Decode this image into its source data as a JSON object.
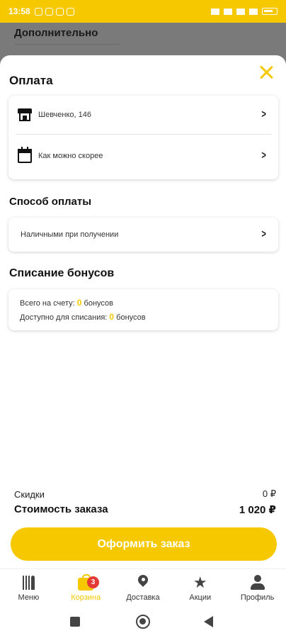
{
  "status_bar": {
    "time": "13:58"
  },
  "background": {
    "title": "Дополнительно"
  },
  "sheet": {
    "section_payment": "Оплата",
    "address": "Шевченко, 146",
    "time_option": "Как можно скорее",
    "section_method": "Способ оплаты",
    "payment_method": "Наличными при получении",
    "section_bonus": "Списание бонусов",
    "bonus_total_label": "Всего на счету:",
    "bonus_total_value": "0",
    "bonus_total_unit": "бонусов",
    "bonus_avail_label": "Доступно для списания:",
    "bonus_avail_value": "0",
    "bonus_avail_unit": "бонусов"
  },
  "summary": {
    "discount_label": "Скидки",
    "discount_value": "0 ₽",
    "total_label": "Стоимость заказа",
    "total_value": "1 020 ₽"
  },
  "order_button": "Оформить заказ",
  "tabs": [
    {
      "label": "Меню",
      "icon": "fork-knife-icon"
    },
    {
      "label": "Корзина",
      "icon": "cart-bag-icon",
      "badge": "3"
    },
    {
      "label": "Доставка",
      "icon": "location-pin-icon"
    },
    {
      "label": "Акции",
      "icon": "star-icon"
    },
    {
      "label": "Профиль",
      "icon": "user-icon"
    }
  ],
  "colors": {
    "accent": "#f5c800",
    "badge": "#e53935"
  }
}
